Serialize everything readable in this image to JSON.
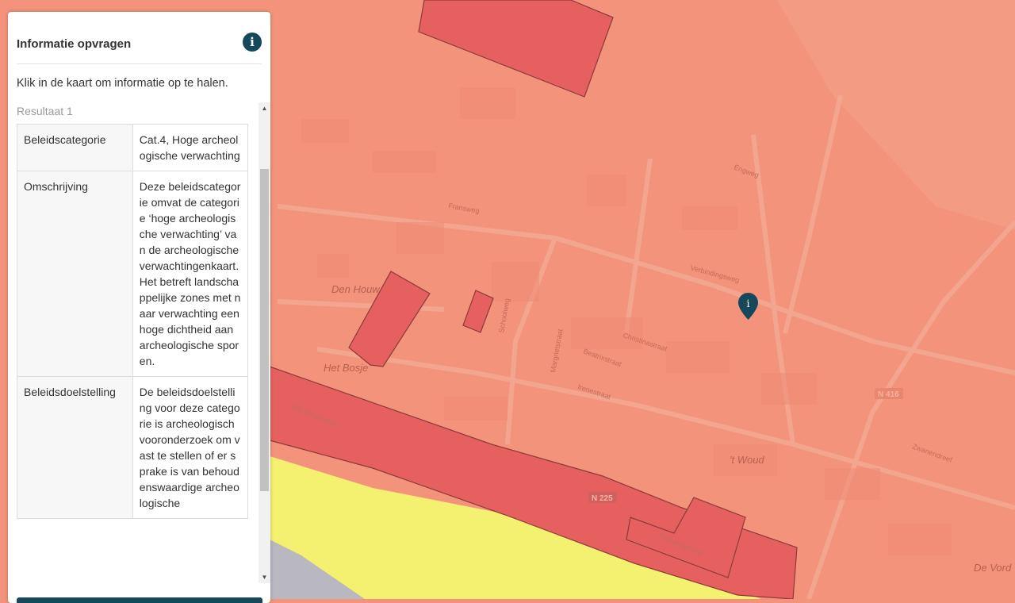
{
  "panel": {
    "title": "Informatie opvragen",
    "info_icon": "info-icon",
    "instruction": "Klik in de kaart om informatie op te halen.",
    "result_title": "Resultaat 1",
    "rows": [
      {
        "key": "Beleidscategorie",
        "value": "Cat.4, Hoge archeologische verwachting"
      },
      {
        "key": "Omschrijving",
        "value": "Deze beleidscategorie omvat de categorie ‘hoge archeologische verwachting’ van de archeologische verwachtingenkaart. Het betreft landschappelijke zones met naar verwachting een hoge dichtheid aan archeologische sporen."
      },
      {
        "key": "Beleidsdoelstelling",
        "value": "De beleidsdoelstelling voor deze categorie is archeologisch vooronderzoek om vast te stellen of er sprake is van behoudenswaardige archeologische"
      }
    ]
  },
  "map": {
    "colors": {
      "high_expectation": "#f3937b",
      "very_high": "#e66060",
      "yellow_zone": "#f4f070",
      "river": "#b9b7c0",
      "marker": "#14485a"
    },
    "place_labels": [
      "Den Houw",
      "Het Bosje",
      "'t Woud",
      "De Vord"
    ],
    "street_labels": [
      "Fransweg",
      "Rijksstraatweg",
      "Rijksstraatweg",
      "Verbindingsweg",
      "Christinastraat",
      "Beatrixstraat",
      "Schoolweg",
      "Engweg",
      "Zwanendreef",
      "Irenestraat",
      "Margrietstraat"
    ],
    "road_badges": [
      "N 416",
      "N 225"
    ],
    "marker_icon": "map-pin-info-icon"
  }
}
